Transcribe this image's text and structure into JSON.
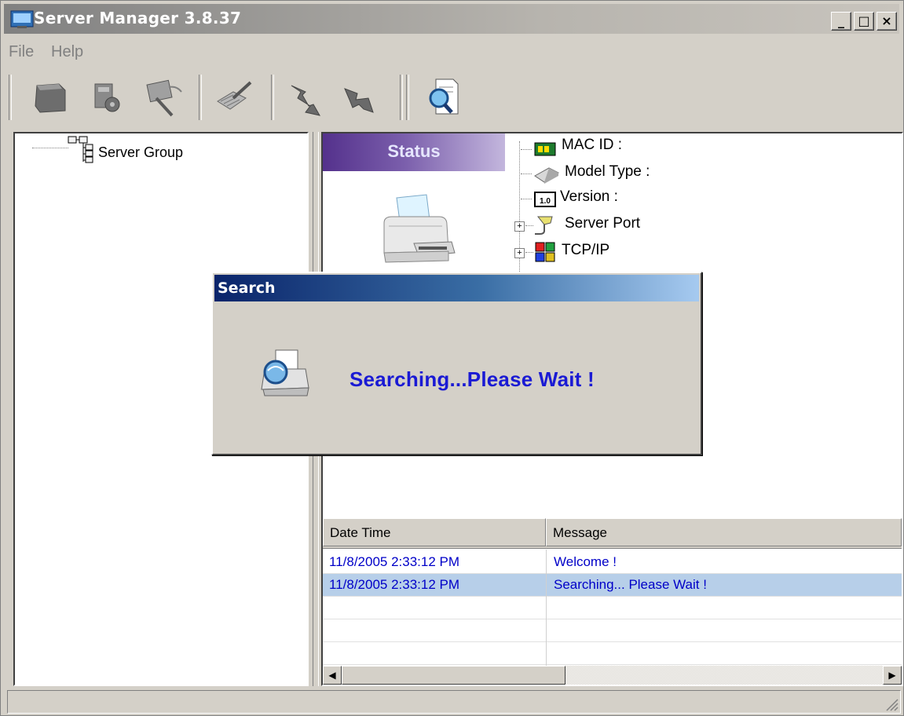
{
  "window": {
    "title": "Server Manager 3.8.37"
  },
  "menu": {
    "items": [
      "File",
      "Help"
    ]
  },
  "toolbar": {
    "buttons": [
      "open-device-icon",
      "config-icon",
      "network-scan-icon",
      "settings-pen-icon",
      "disconnect-icon",
      "reconnect-icon",
      "search-icon"
    ]
  },
  "tree": {
    "root": "Server Group"
  },
  "status_panel": {
    "header": "Status",
    "properties": [
      {
        "icon": "chip-icon",
        "label": "MAC ID :",
        "expandable": false
      },
      {
        "icon": "model-icon",
        "label": "Model Type :",
        "expandable": false
      },
      {
        "icon": "version-icon",
        "label": "Version :",
        "expandable": false
      },
      {
        "icon": "port-icon",
        "label": "Server Port",
        "expandable": true
      },
      {
        "icon": "tcpip-icon",
        "label": "TCP/IP",
        "expandable": true
      }
    ]
  },
  "log": {
    "columns": [
      "Date Time",
      "Message"
    ],
    "rows": [
      {
        "time": "11/8/2005 2:33:12 PM",
        "message": "Welcome !",
        "selected": false
      },
      {
        "time": "11/8/2005 2:33:12 PM",
        "message": "Searching... Please Wait !",
        "selected": true
      }
    ]
  },
  "dialog": {
    "title": "Search",
    "message": "Searching...Please Wait !"
  },
  "colors": {
    "accent": "#0a246a",
    "status_header": "#54318c",
    "log_text": "#0000c8"
  }
}
